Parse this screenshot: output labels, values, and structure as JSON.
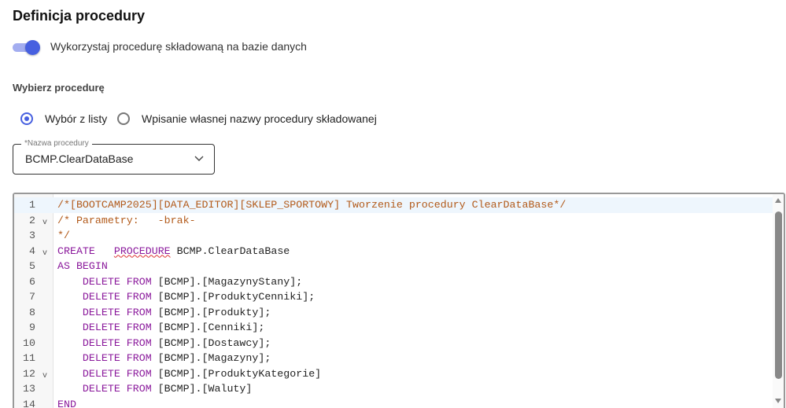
{
  "title": "Definicja procedury",
  "toggle": {
    "label": "Wykorzystaj procedurę składowaną na bazie danych",
    "on": true
  },
  "section_title": "Wybierz procedurę",
  "radios": [
    {
      "label": "Wybór z listy",
      "checked": true
    },
    {
      "label": "Wpisanie własnej nazwy procedury składowanej",
      "checked": false
    }
  ],
  "select": {
    "label": "*Nazwa procedury",
    "value": "BCMP.ClearDataBase"
  },
  "accent_color": "#4760e0",
  "editor": {
    "lines": [
      {
        "n": "1",
        "fold": "",
        "tokens": [
          {
            "t": "/*[BOOTCAMP2025][DATA_EDITOR][SKLEP_SPORTOWY] Tworzenie procedury ClearDataBase*/",
            "k": "c"
          }
        ]
      },
      {
        "n": "2",
        "fold": "v",
        "tokens": [
          {
            "t": "/* Parametry:   -brak-",
            "k": "c"
          }
        ]
      },
      {
        "n": "3",
        "fold": "",
        "tokens": [
          {
            "t": "*/",
            "k": "c"
          }
        ]
      },
      {
        "n": "4",
        "fold": "v",
        "tokens": [
          {
            "t": "CREATE",
            "k": "k"
          },
          {
            "t": "   ",
            "k": ""
          },
          {
            "t": "PROCEDURE",
            "k": "k sq"
          },
          {
            "t": " BCMP.ClearDataBase",
            "k": ""
          }
        ]
      },
      {
        "n": "5",
        "fold": "",
        "tokens": [
          {
            "t": "AS BEGIN",
            "k": "k"
          }
        ]
      },
      {
        "n": "6",
        "fold": "",
        "tokens": [
          {
            "t": "    ",
            "k": ""
          },
          {
            "t": "DELETE FROM",
            "k": "k"
          },
          {
            "t": " [BCMP].[MagazynyStany];",
            "k": ""
          }
        ]
      },
      {
        "n": "7",
        "fold": "",
        "tokens": [
          {
            "t": "    ",
            "k": ""
          },
          {
            "t": "DELETE FROM",
            "k": "k"
          },
          {
            "t": " [BCMP].[ProduktyCenniki];",
            "k": ""
          }
        ]
      },
      {
        "n": "8",
        "fold": "",
        "tokens": [
          {
            "t": "    ",
            "k": ""
          },
          {
            "t": "DELETE FROM",
            "k": "k"
          },
          {
            "t": " [BCMP].[Produkty];",
            "k": ""
          }
        ]
      },
      {
        "n": "9",
        "fold": "",
        "tokens": [
          {
            "t": "    ",
            "k": ""
          },
          {
            "t": "DELETE FROM",
            "k": "k"
          },
          {
            "t": " [BCMP].[Cenniki];",
            "k": ""
          }
        ]
      },
      {
        "n": "10",
        "fold": "",
        "tokens": [
          {
            "t": "    ",
            "k": ""
          },
          {
            "t": "DELETE FROM",
            "k": "k"
          },
          {
            "t": " [BCMP].[Dostawcy];",
            "k": ""
          }
        ]
      },
      {
        "n": "11",
        "fold": "",
        "tokens": [
          {
            "t": "    ",
            "k": ""
          },
          {
            "t": "DELETE FROM",
            "k": "k"
          },
          {
            "t": " [BCMP].[Magazyny];",
            "k": ""
          }
        ]
      },
      {
        "n": "12",
        "fold": "v",
        "tokens": [
          {
            "t": "    ",
            "k": ""
          },
          {
            "t": "DELETE FROM",
            "k": "k"
          },
          {
            "t": " [BCMP].[ProduktyKategorie]",
            "k": ""
          }
        ]
      },
      {
        "n": "13",
        "fold": "",
        "tokens": [
          {
            "t": "    ",
            "k": ""
          },
          {
            "t": "DELETE FROM",
            "k": "k"
          },
          {
            "t": " [BCMP].[Waluty]",
            "k": ""
          }
        ]
      },
      {
        "n": "14",
        "fold": "",
        "tokens": [
          {
            "t": "END",
            "k": "k"
          }
        ]
      }
    ]
  }
}
